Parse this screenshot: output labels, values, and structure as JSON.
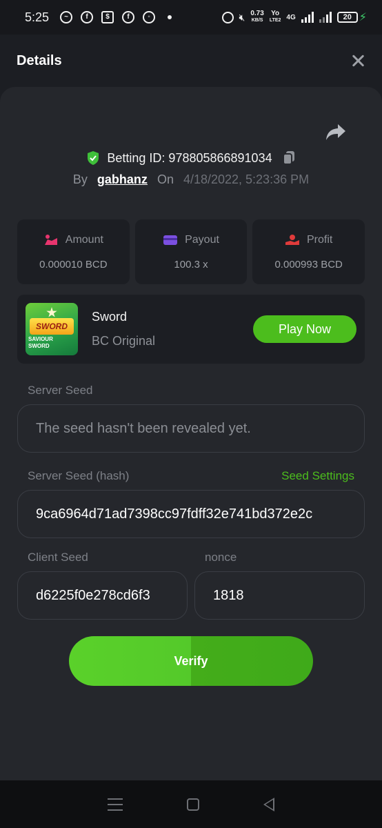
{
  "status_bar": {
    "time": "5:25",
    "speed_value": "0.73",
    "speed_unit": "KB/S",
    "volte_top": "Yo",
    "volte_bottom": "LTE2",
    "network": "4G",
    "battery": "20"
  },
  "header": {
    "title": "Details"
  },
  "bet": {
    "id_label": "Betting ID: 978805866891034",
    "by_label": "By",
    "user": "gabhanz",
    "on_label": "On",
    "datetime": "4/18/2022, 5:23:36 PM"
  },
  "stats": [
    {
      "icon": "amount-icon",
      "label": "Amount",
      "value": "0.000010 BCD",
      "color": "#e8356e"
    },
    {
      "icon": "payout-icon",
      "label": "Payout",
      "value": "100.3 x",
      "color": "#7b4fe0"
    },
    {
      "icon": "profit-icon",
      "label": "Profit",
      "value": "0.000993 BCD",
      "color": "#e03b3b"
    }
  ],
  "game": {
    "thumb_title": "SWORD",
    "thumb_sub": "SAVIOUR SWORD",
    "name": "Sword",
    "provider": "BC Original",
    "play_label": "Play Now"
  },
  "seeds": {
    "server_seed_label": "Server Seed",
    "server_seed_value": "The seed hasn't been revealed yet.",
    "server_hash_label": "Server Seed (hash)",
    "seed_settings_label": "Seed Settings",
    "server_hash_value": "9ca6964d71ad7398cc97fdff32e741bd372e2c",
    "client_seed_label": "Client Seed",
    "client_seed_value": "d6225f0e278cd6f3",
    "nonce_label": "nonce",
    "nonce_value": "1818"
  },
  "verify_label": "Verify",
  "colors": {
    "accent_green": "#4cbd1d",
    "shield_green": "#3fbf3a"
  }
}
